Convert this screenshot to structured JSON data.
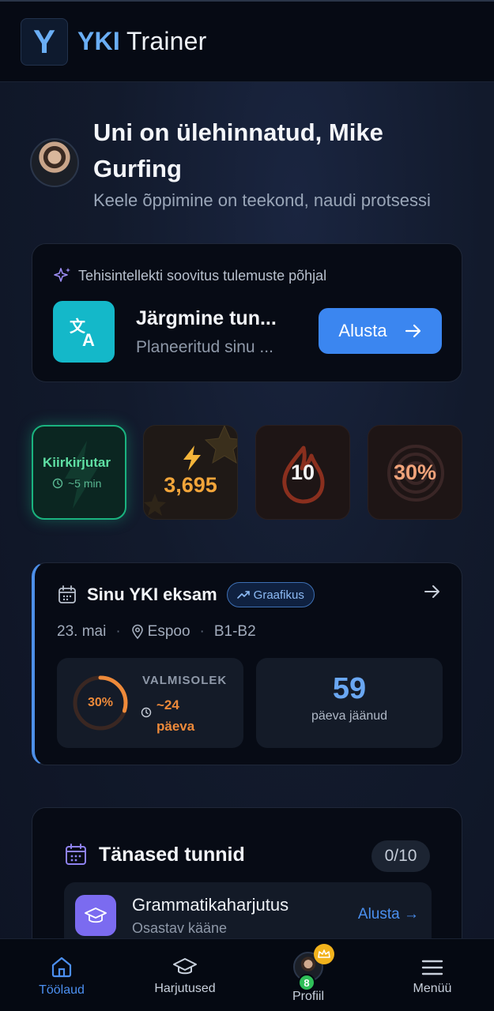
{
  "header": {
    "logo_letter": "Y",
    "brand_bold": "YKI",
    "brand_rest": "Trainer"
  },
  "greeting": {
    "title": "Uni on ülehinnatud, Mike Gurfing",
    "subtitle": "Keele õppimine on teekond, naudi protsessi"
  },
  "ai_card": {
    "header": "Tehisintellekti soovitus tulemuste põhjal",
    "lesson_title": "Järgmine tun...",
    "lesson_subtitle": "Planeeritud sinu ...",
    "button_label": "Alusta"
  },
  "stats": {
    "speedwriting": {
      "label": "Kiirkirjutar",
      "time": "~5 min"
    },
    "xp": {
      "value": "3,695"
    },
    "streak": {
      "value": "10"
    },
    "accuracy": {
      "value": "30%",
      "fraction": 0.3
    }
  },
  "exam": {
    "title": "Sinu YKI eksam",
    "schedule_label": "Graafikus",
    "date": "23. mai",
    "location": "Espoo",
    "level": "B1-B2",
    "readiness_pct": "30%",
    "readiness_fraction": 0.3,
    "readiness_label": "VALMISOLEK",
    "readiness_time_line1": "~24",
    "readiness_time_line2": "päeva",
    "days_left": "59",
    "days_left_label": "päeva jäänud"
  },
  "today": {
    "title": "Tänased tunnid",
    "count": "0/10",
    "lessons": [
      {
        "title": "Grammatikaharjutus",
        "subtitle": "Osastav kääne",
        "action": "Alusta →"
      }
    ]
  },
  "nav": {
    "home": "Töölaud",
    "exercises": "Harjutused",
    "profile": "Profiil",
    "profile_level": "8",
    "menu": "Menüü"
  },
  "colors": {
    "accent": "#3b86f0",
    "speed_green": "#1ab37f",
    "xp_orange": "#f2a53a",
    "readiness_orange": "#ee8a3a",
    "lesson_cyan": "#14b8c9",
    "lesson_purple": "#7b6bf0"
  }
}
